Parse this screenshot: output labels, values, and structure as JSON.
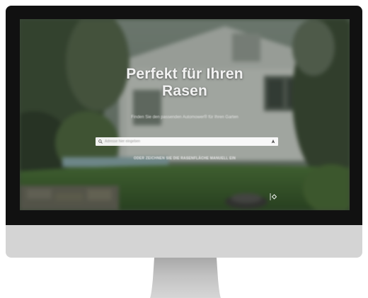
{
  "hero": {
    "title_line1": "Perfekt für Ihren",
    "title_line2": "Rasen",
    "subtitle": "Finden Sie den passenden Automower® für Ihren Garten"
  },
  "search": {
    "placeholder": "Adresse hier eingeben",
    "icon": "search-icon",
    "locate_icon": "crosshair-icon"
  },
  "map_link": {
    "label": "ODER ZEICHNEN SIE DIE RASENFLÄCHE MANUELL EIN"
  },
  "marker": {
    "icon": "location-marker-icon"
  },
  "colors": {
    "bezel": "#111111",
    "chin": "#d4d4d4",
    "stand": "#b8b8b8",
    "title_text": "#f2f2f2"
  }
}
